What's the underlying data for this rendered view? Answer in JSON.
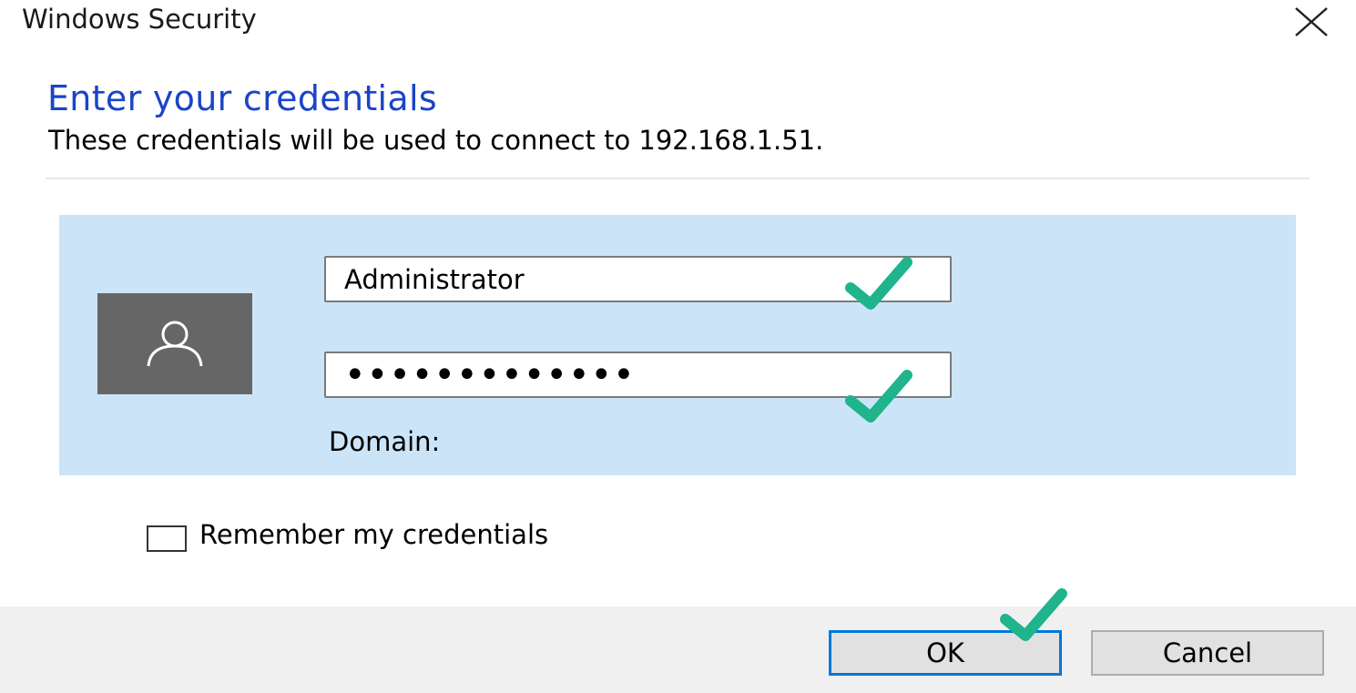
{
  "window": {
    "title": "Windows Security",
    "close_icon": "close-icon"
  },
  "dialog": {
    "heading": "Enter your credentials",
    "description": "These credentials will be used to connect to 192.168.1.51."
  },
  "credentials": {
    "user_icon": "user-icon",
    "username_value": "Administrator",
    "password_mask": "•••••••••••••",
    "domain_label": "Domain:"
  },
  "remember": {
    "label": "Remember my credentials",
    "checked": false
  },
  "buttons": {
    "ok_label": "OK",
    "cancel_label": "Cancel"
  },
  "annotations": {
    "check_icon": "checkmark-icon",
    "check_color": "#1fb48b"
  },
  "colors": {
    "accent": "#0078d7",
    "heading": "#1a44c8",
    "panel": "#cce4f7",
    "user_tile": "#666666"
  }
}
